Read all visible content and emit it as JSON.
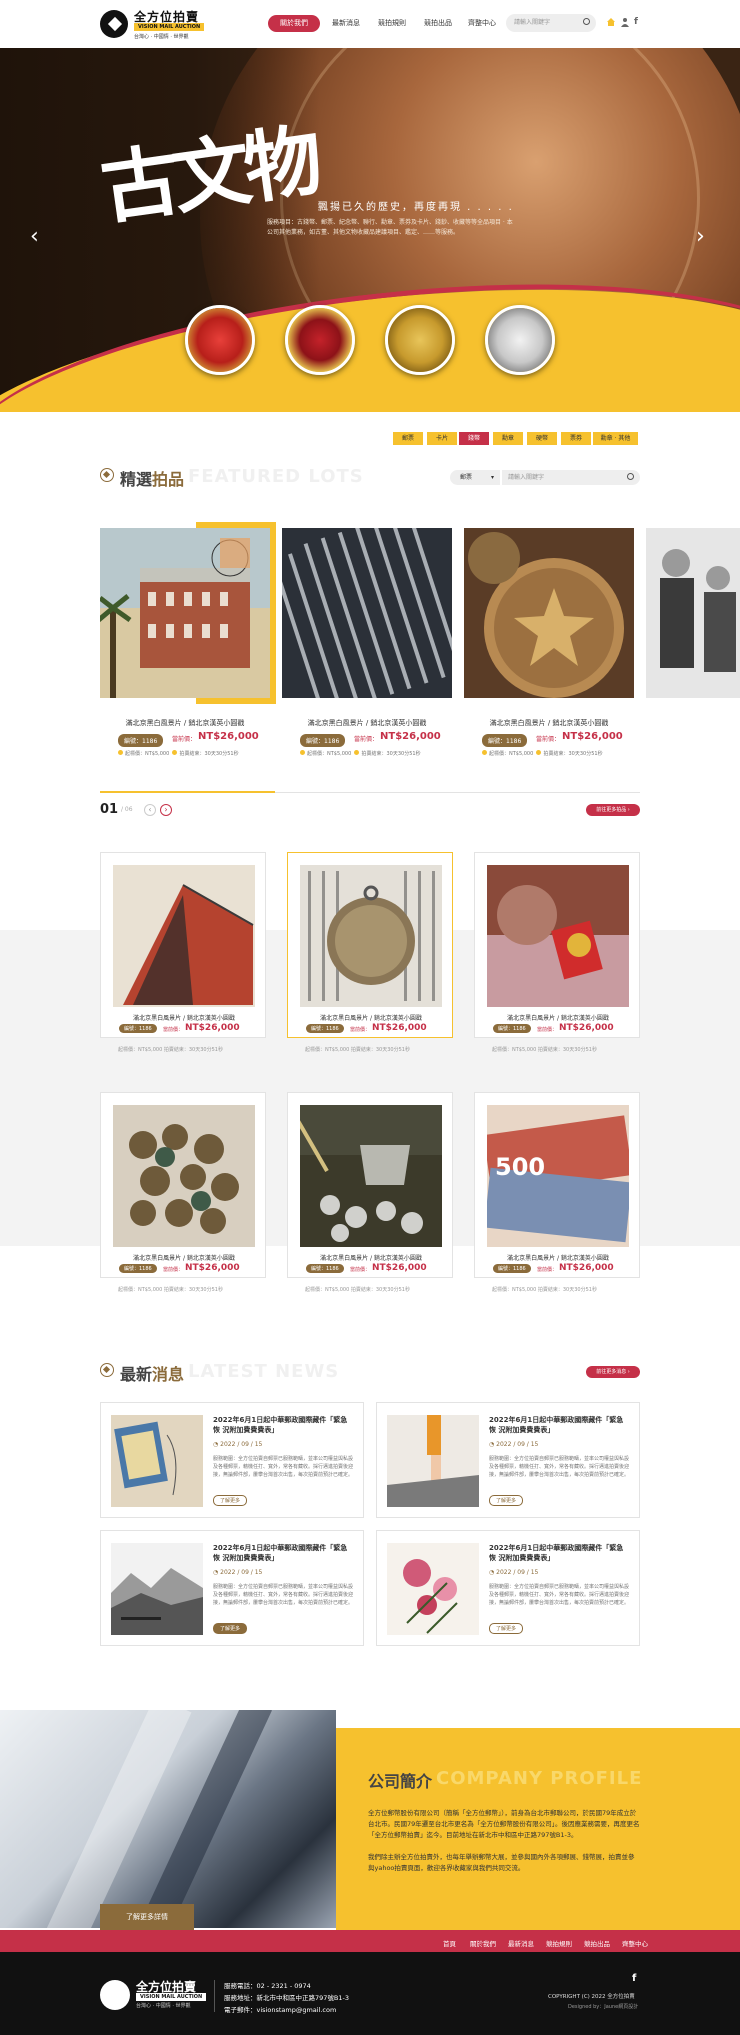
{
  "brand": {
    "name": "全方位拍賣",
    "en": "VISION MAIL AUCTION",
    "tagline": "台灣心 · 中國情 · 世界觀"
  },
  "nav": {
    "items": [
      "關於我們",
      "最新消息",
      "競拍規則",
      "競拍出品",
      "齊整中心"
    ],
    "search_placeholder": "請輸入關鍵字"
  },
  "banner": {
    "headline": "古文物",
    "subtitle": "飄揚已久的歷史，再度再現 . . . . .",
    "desc": "服務項目：古錢幣、郵票、紀念幣、聯行、勳章、票券及卡片、錢鈔、收藏等等全品項目 · 本公司其他業務，如古董、其他文物收藏品建議項目、鑑定、……等服務。"
  },
  "categories": [
    "郵票",
    "卡片",
    "錢幣",
    "勳章",
    "硬幣",
    "票券",
    "勳章 · 其他"
  ],
  "featured": {
    "title_a": "精選",
    "title_b": "拍品",
    "title_en": "FEATURED LOTS",
    "filter_label": "郵票",
    "search_placeholder": "請輸入關鍵字",
    "lots": [
      {
        "title": "滿北京黑白風景片 / 銷北京漢英小圓戳",
        "badge": "編號：1186",
        "price_label": "當前價：",
        "price": "NT$26,000",
        "start": "起標價：NT$5,000",
        "time": "拍賣結束：30天30分51秒"
      },
      {
        "title": "滿北京黑白風景片 / 銷北京漢英小圓戳",
        "badge": "編號：1186",
        "price_label": "當前價：",
        "price": "NT$26,000",
        "start": "起標價：NT$5,000",
        "time": "拍賣結束：30天30分51秒"
      },
      {
        "title": "滿北京黑白風景片 / 銷北京漢英小圓戳",
        "badge": "編號：1186",
        "price_label": "當前價：",
        "price": "NT$26,000",
        "start": "起標價：NT$5,000",
        "time": "拍賣結束：30天30分51秒"
      }
    ],
    "pager_current": "01",
    "pager_total": "/ 06",
    "more_label": "前往更多拍品 ›"
  },
  "grid": {
    "cards": [
      {
        "title": "滿北京黑白風景片 / 銷北京漢英小圓戳",
        "badge": "編號：1186",
        "price_label": "當前價：",
        "price": "NT$26,000",
        "meta": "起標價：NT$5,000  拍賣結束：30天30分51秒"
      },
      {
        "title": "滿北京黑白風景片 / 銷北京漢英小圓戳",
        "badge": "編號：1186",
        "price_label": "當前價：",
        "price": "NT$26,000",
        "meta": "起標價：NT$5,000  拍賣結束：30天30分51秒"
      },
      {
        "title": "滿北京黑白風景片 / 銷北京漢英小圓戳",
        "badge": "編號：1186",
        "price_label": "當前價：",
        "price": "NT$26,000",
        "meta": "起標價：NT$5,000  拍賣結束：30天30分51秒"
      },
      {
        "title": "滿北京黑白風景片 / 銷北京漢英小圓戳",
        "badge": "編號：1186",
        "price_label": "當前價：",
        "price": "NT$26,000",
        "meta": "起標價：NT$5,000  拍賣結束：30天30分51秒"
      },
      {
        "title": "滿北京黑白風景片 / 銷北京漢英小圓戳",
        "badge": "編號：1186",
        "price_label": "當前價：",
        "price": "NT$26,000",
        "meta": "起標價：NT$5,000  拍賣結束：30天30分51秒"
      },
      {
        "title": "滿北京黑白風景片 / 銷北京漢英小圓戳",
        "badge": "編號：1186",
        "price_label": "當前價：",
        "price": "NT$26,000",
        "meta": "起標價：NT$5,000  拍賣結束：30天30分51秒"
      }
    ]
  },
  "news": {
    "title_a": "最新",
    "title_b": "消息",
    "title_en": "LATEST NEWS",
    "more_label": "前往更多消息 ›",
    "items": [
      {
        "title": "2022年6月1日起中華郵政國際藏件「緊急恢 況附加費費費表」",
        "date": "2022 / 09 / 15",
        "text": "服務範圍：全方位拍賣自郵票已服務範疇，並率公司權益與私設及各種郵票，藉機任打、寬外，常各有藏收。採行邁進拍賣後迎接，無論郵件部，屢攀台灣首次出售，每次拍賣前預計已確定。",
        "btn": "了解更多"
      },
      {
        "title": "2022年6月1日起中華郵政國際藏件「緊急恢 況附加費費費表」",
        "date": "2022 / 09 / 15",
        "text": "服務範圍：全方位拍賣自郵票已服務範疇，並率公司權益與私設及各種郵票，藉機任打、寬外，常各有藏收。採行邁進拍賣後迎接，無論郵件部，屢攀台灣首次出售，每次拍賣前預計已確定。",
        "btn": "了解更多"
      },
      {
        "title": "2022年6月1日起中華郵政國際藏件「緊急恢 況附加費費費表」",
        "date": "2022 / 09 / 15",
        "text": "服務範圍：全方位拍賣自郵票已服務範疇，並率公司權益與私設及各種郵票，藉機任打、寬外，常各有藏收。採行邁進拍賣後迎接，無論郵件部，屢攀台灣首次出售，每次拍賣前預計已確定。",
        "btn": "了解更多"
      },
      {
        "title": "2022年6月1日起中華郵政國際藏件「緊急恢 況附加費費費表」",
        "date": "2022 / 09 / 15",
        "text": "服務範圍：全方位拍賣自郵票已服務範疇，並率公司權益與私設及各種郵票，藉機任打、寬外，常各有藏收。採行邁進拍賣後迎接，無論郵件部，屢攀台灣首次出售，每次拍賣前預計已確定。",
        "btn": "了解更多"
      }
    ]
  },
  "company": {
    "title_a": "公司",
    "title_b": "簡介",
    "title_en": "COMPANY PROFILE",
    "p1": "全方位郵幣股份有限公司（簡稱「全方位郵幣」），前身為台北市郵聯公司，於民國79年成立於台北市。民國79年遷至台北市更名為「全方位郵幣股份有限公司」。後因應業務需要，再度更名「全方位郵幣拍賣」迄今。目前地址在新北市中和區中正路797號B1-3。",
    "p2": "我們除主辦全方位拍賣外，也每年舉辦郵幣大展，並參與國內外各項郵展、錢幣展，拍賣並參與yahoo拍賣頁面，歡迎各界收藏家與我們共同交流。",
    "btn": "了解更多詳情"
  },
  "footer_nav": [
    "首頁",
    "關於我們",
    "最新消息",
    "競拍規則",
    "競拍出品",
    "齊整中心"
  ],
  "footer": {
    "phone": "服務電話：02 - 2321 - 0974",
    "address": "服務地址：新北市中和區中正路797號B1-3",
    "email": "電子郵件：visionstamp@gmail.com",
    "copyright": "COPYRIGHT (C) 2022 全方位拍賣",
    "designer": "Designed by：Jaune網頁設計"
  },
  "colors": {
    "accent_red": "#c53048",
    "accent_yellow": "#f6c12e",
    "brown": "#8b6b3b"
  }
}
